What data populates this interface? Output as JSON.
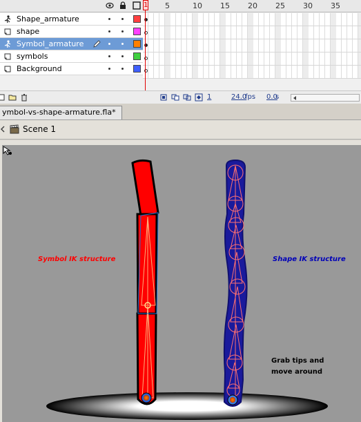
{
  "timeline": {
    "frame_numbers": [
      "1",
      "5",
      "10",
      "15",
      "20",
      "25",
      "30",
      "35"
    ],
    "playhead_frame": "1",
    "layers": [
      {
        "name": "Shape_armature",
        "type": "armature-layer-icon",
        "color": "#ff4040",
        "selected": false
      },
      {
        "name": "shape",
        "type": "normal-layer-icon",
        "color": "#ff40ff",
        "selected": false
      },
      {
        "name": "Symbol_armature",
        "type": "armature-layer-icon",
        "color": "#ff8000",
        "selected": true
      },
      {
        "name": "symbols",
        "type": "normal-layer-icon",
        "color": "#40d040",
        "selected": false
      },
      {
        "name": "Background",
        "type": "normal-layer-icon",
        "color": "#4060ff",
        "selected": false
      }
    ],
    "footer": {
      "current_frame": "1",
      "fps": "24.0",
      "fps_unit": "fps",
      "time": "0.0",
      "time_unit": "s"
    }
  },
  "document": {
    "tab_title": "ymbol-vs-shape-armature.fla*",
    "scene_name": "Scene 1"
  },
  "stage": {
    "label_symbol": "Symbol IK structure",
    "label_shape": "Shape IK structure",
    "label_grab": "Grab tips and move around",
    "colors": {
      "symbol_fill": "#ff0000",
      "shape_fill": "#1a1a9c",
      "stage_bg": "#999999"
    }
  }
}
